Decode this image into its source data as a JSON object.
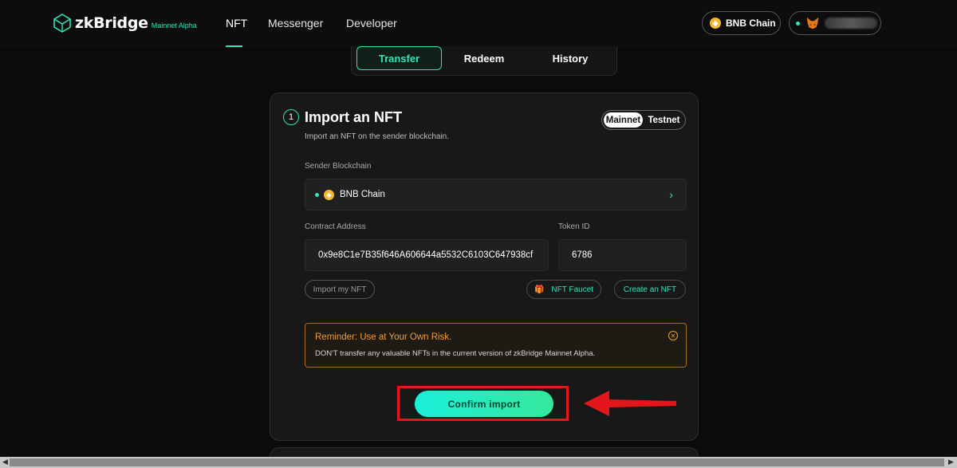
{
  "header": {
    "logo_text": "zkBridge",
    "logo_sub": "Mainnet Alpha",
    "nav": [
      "NFT",
      "Messenger",
      "Developer"
    ],
    "chain_button": "BNB Chain",
    "wallet_icon": "metamask-fox-icon"
  },
  "tabs": [
    "Transfer",
    "Redeem",
    "History"
  ],
  "card": {
    "step": "1",
    "title": "Import an NFT",
    "subtitle": "Import an NFT on the sender blockchain.",
    "network_toggle": {
      "selected": "Mainnet",
      "other": "Testnet"
    },
    "sender_label": "Sender Blockchain",
    "sender_value": "BNB Chain",
    "contract_label": "Contract Address",
    "contract_value": "0x9e8C1e7B35f646A606644a5532C6103C647938cf",
    "token_label": "Token ID",
    "token_value": "6786",
    "import_my_nft": "Import my NFT",
    "nft_faucet": "NFT Faucet",
    "create_nft": "Create an NFT",
    "reminder_title": "Reminder: Use at Your Own Risk.",
    "reminder_text": "DON'T transfer any valuable NFTs in the current version of zkBridge Mainnet Alpha.",
    "confirm": "Confirm import"
  },
  "colors": {
    "accent": "#2ee6b8",
    "warning": "#f29b38",
    "annotation": "#e3161b",
    "bnb": "#f3ba2f"
  }
}
